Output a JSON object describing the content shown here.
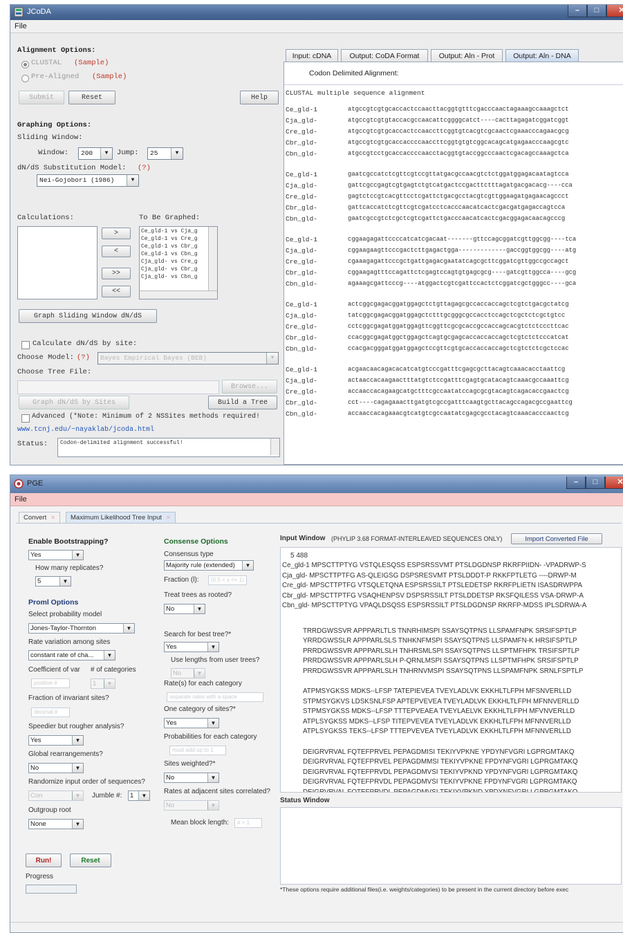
{
  "jcoda": {
    "title": "JCoDA",
    "menu": "File",
    "alignment_options": "Alignment Options:",
    "clustal": "CLUSTAL",
    "prealigned": "Pre-Aligned",
    "sample": "(Sample)",
    "submit": "Submit",
    "reset": "Reset",
    "help": "Help",
    "graphing_options": "Graphing Options:",
    "sliding_window": "Sliding Window:",
    "window_label": "Window:",
    "window_value": "200",
    "jump_label": "Jump:",
    "jump_value": "25",
    "model_label": "dN/dS Substitution Model:",
    "help_mark": "(?)",
    "model_value": "Nei-Gojobori (1986)",
    "calculations": "Calculations:",
    "to_be_graphed": "To Be Graphed:",
    "graphed_items": [
      "Ce_gld-1 vs Cja_g",
      "Ce_gld-1 vs Cre_g",
      "Ce_gld-1 vs Cbr_g",
      "Ce_gld-1 vs Cbn_g",
      "Cja_gld- vs Cre_g",
      "Cja_gld- vs Cbr_g",
      "Cja_gld- vs Cbn_g"
    ],
    "move_right": ">",
    "move_left": "<",
    "move_all_right": ">>",
    "move_all_left": "<<",
    "graph_btn": "Graph Sliding Window dN/dS",
    "calc_by_site": "Calculate dN/dS by site:",
    "choose_model": "Choose Model:",
    "choose_model_value": "Bayes Empirical Bayes (BEB)",
    "choose_tree": "Choose Tree File:",
    "browse": "Browse...",
    "graph_sites": "Graph dN/dS by Sites",
    "build_tree": "Build a Tree",
    "advanced": "Advanced (*Note: Minimum of 2 NSSites methods required!",
    "url": "www.tcnj.edu/~nayaklab/jcoda.html",
    "status_label": "Status:",
    "status_value": "Codon-delimited alignment successful!",
    "tabs": [
      "Input: cDNA",
      "Output: CoDA Format",
      "Output: Aln - Prot",
      "Output: Aln - DNA"
    ],
    "panel_title": "Codon Delimited Alignment:",
    "clustal_header": "CLUSTAL multiple sequence alignment",
    "alignment_blocks": [
      [
        {
          "name": "Ce_gld-1",
          "seq": "atgccgtcgtgcaccactccaacttacggtgtttcgacccaactagaaagccaaagctct"
        },
        {
          "name": "Cja_gld-",
          "seq": "atgccgtcgtgtaccacgccaacattcggggcatct----cacttagagatcggatcggt"
        },
        {
          "name": "Cre_gld-",
          "seq": "atgccgtcgtgcaccactccaaccttcggtgtcacgtcgcaactcgaaacccagaacgcg"
        },
        {
          "name": "Cbr_gld-",
          "seq": "atgccgtcgtgcaccaccccaaccttcggtgtgtcggcacagcatgagaacccaagcgtc"
        },
        {
          "name": "Cbn_gld-",
          "seq": "atgccgtcctgcaccaccccaacctacggtgtaccggcccaactcgacagccaaagctca"
        }
      ],
      [
        {
          "name": "Ce_gld-1",
          "seq": "gaatcgccatctcgttcgtccgttatgacgccaacgtctctggatggagacaatagtcca"
        },
        {
          "name": "Cja_gld-",
          "seq": "gattcgccgagtcgtgagtctgtcatgactccgacttctttagatgacgacacg----cca"
        },
        {
          "name": "Cre_gld-",
          "seq": "gagtctccgtcacgttcctcgattctgacgcctacgtcgttggaagatgagaacagccct"
        },
        {
          "name": "Cbr_gld-",
          "seq": "gattcaccatctcgttcgtcgatcctcacccaacatcactcgacgatgagaccagtcca"
        },
        {
          "name": "Cbn_gld-",
          "seq": "gaatcgccgtctcgctcgtcgattctgacccaacatcactcgacggagacaacagcccg"
        }
      ],
      [
        {
          "name": "Ce_gld-1",
          "seq": "cggaagagattccccatcatcgacaat-------gttccagcggatcgttggcgg----tca"
        },
        {
          "name": "Cja_gld-",
          "seq": "cggaagaagttcccgactcttgagactgga-------------gaccggtggcgg----atg"
        },
        {
          "name": "Cre_gld-",
          "seq": "cgaaagagattcccgctgattgagacgaatatcagcgcttcggatcgttggccgccagct"
        },
        {
          "name": "Cbr_gld-",
          "seq": "cggaagagtttccagattctcgagtccagtgtgagcgcg----gatcgttggcca----gcg"
        },
        {
          "name": "Cbn_gld-",
          "seq": "agaaagcgattcccg----atggactcgtcgattccactctcggatcgctgggcc----gca"
        }
      ],
      [
        {
          "name": "Ce_gld-1",
          "seq": "actcggcgagacggatggagctctgttagagcgccaccaccagctcgtctgacgctatcg"
        },
        {
          "name": "Cja_gld-",
          "seq": "tatcggcgagacggatggagctctttgcgggcgccacctccagctcgctctcgctgtcc"
        },
        {
          "name": "Cre_gld-",
          "seq": "cctcggcgagatggatggagttcggttcgcgcaccgccaccagcacgtctctcccttcac"
        },
        {
          "name": "Cbr_gld-",
          "seq": "ccacggcgagatggctggagctcagtgcgagcaccaccaccagctcgtctctcccatcat"
        },
        {
          "name": "Cbn_gld-",
          "seq": "ccacgacgggatggatggagctccgttcgtgcaccaccaccagctcgtctctcgctccac"
        }
      ],
      [
        {
          "name": "Ce_gld-1",
          "seq": "acgaacaacagacacatcatgtcccgatttcgagcgcttacagtcaaacacctaattcg"
        },
        {
          "name": "Cja_gld-",
          "seq": "actaaccacaagaactttatgtctccgatttcgagtgcatacagtcaaacgccaaattcg"
        },
        {
          "name": "Cre_gld-",
          "seq": "accaaccacagaagcatgctttcgccaatatccagcgcgtacagtcagacaccgaactcg"
        },
        {
          "name": "Cbr_gld-",
          "seq": "cct----cagagaaacttgatgtcgccgatttcaagtgcttacagccagacgccgaattcg"
        },
        {
          "name": "Cbn_gld-",
          "seq": "accaaccacagaaacgtcatgtcgccaatatcgagcgcctacagtcaaacacccaactcg"
        }
      ]
    ]
  },
  "pge": {
    "title": "PGE",
    "menu": "File",
    "tabs": [
      "Convert",
      "Maximum Likelihood Tree Input"
    ],
    "enable_bootstrapping": "Enable Bootstrapping?",
    "bootstrap_value": "Yes",
    "replicates_label": "How many replicates?",
    "replicates_value": "5",
    "proml_options": "Proml Options",
    "prob_model_label": "Select probability model",
    "prob_model_value": "Jones-Taylor-Thornton",
    "rate_variation_label": "Rate variation among sites",
    "rate_variation_value": "constant rate of cha...",
    "coef_var_label": "Coefficient of var",
    "num_categories_label": "# of categories",
    "coef_var_field": "positive #",
    "num_categories_value": "1",
    "invariant_label": "Fraction of invariant sites?",
    "invariant_field": "decimal #",
    "speedier_label": "Speedier but rougher analysis?",
    "speedier_value": "Yes",
    "global_rearr_label": "Global rearrangements?",
    "global_rearr_value": "No",
    "randomize_label": "Randomize input order of sequences?",
    "randomize_value": "Con",
    "jumble_label": "Jumble #:",
    "jumble_value": "1",
    "outgroup_label": "Outgroup root",
    "outgroup_value": "None",
    "run": "Run!",
    "reset": "Reset",
    "progress": "Progress",
    "consense_options": "Consense Options",
    "consensus_type_label": "Consensus type",
    "consensus_type_value": "Majority rule (extended)",
    "fraction_label": "Fraction (l):",
    "fraction_field": "(0.5 < x <= 1)",
    "treat_rooted_label": "Treat trees as rooted?",
    "treat_rooted_value": "No",
    "best_tree_label": "Search for best tree?*",
    "best_tree_value": "Yes",
    "use_lengths_label": "Use lengths from user trees?",
    "use_lengths_value": "No",
    "rates_category_label": "Rate(s) for each category",
    "rates_category_field": "separate rates with a space",
    "one_category_label": "One category of sites?*",
    "one_category_value": "Yes",
    "probabilities_label": "Probabilities for each category",
    "probabilities_field": "must add up to 1",
    "sites_weighted_label": "Sites weighted?*",
    "sites_weighted_value": "No",
    "adjacent_label": "Rates at adjacent sites correlated?",
    "adjacent_value": "No",
    "mean_block_label": "Mean block length:",
    "mean_block_field": "# > 1",
    "input_window_label": "Input Window",
    "input_window_note": "(PHYLIP 3.68 FORMAT-INTERLEAVED SEQUENCES ONLY)",
    "import_btn": "Import Converted File",
    "seq_header": "5  488",
    "seq_first_block": [
      "Ce_gld-1  MPSCTTPTYG VSTQLESQSS ESPSRSSVMT PTSLDGDNSP RKRFPIIDN- -VPADRWP-S",
      "Cja_gld-  MPSCTTPTFG AS-QLEIGSG DSPSRESVMT PTSLDDDT-P RKKFPTLETG ----DRWP-M",
      "Cre_gld-  MPSCTTPTFG VTSQLETQNA ESPSRSSILT PTSLEDETSP RKRFPLIETN ISASDRWPPA",
      "Cbr_gld-  MPSCTTPTFG VSAQHENPSV DSPSRSSILT PTSLDDETSP RKSFQILESS VSA-DRWP-A",
      "Cbn_gld-  MPSCTTPTYG VPAQLDSQSS ESPSRSSILT PTSLDGDNSP RKRFP-MDSS IPLSDRWA-A"
    ],
    "seq_blocks": [
      [
        "TRRDGWSSVR APPPARLTLS TNNRHIMSPI SSAYSQTPNS LLSPAMFNPK SRSIFSPTLP",
        "YRRDGWSSLR APPPARLSLS TNHKNFMSPI SSAYSQTPNS LLSPAMFN-K HRSIFSPTLP",
        "PRRDGWSSVR APPPARLSLH TNHRSMLSPI SSAYSQTPNS LLSPTMFHPK TRSIFSPTLP",
        "PRRDGWSSVR APPPARLSLH P-QRNLMSPI SSAYSQTPNS LLSPTMFHPK SRSIFSPTLP",
        "PRRDGWSSVR APPPARLSLH TNHRNVMSPI SSAYSQTPNS LLSPAMFNPK SRNLFSPTLP"
      ],
      [
        "ATPMSYGKSS MDKS--LFSP TATEPIEVEA TVEYLADLVK EKKHLTLFPH MFSNVERLLD",
        "STPMSYGKVS LDSKSNLFSP APTEPVEVEA TVEYLADLVK EKKHLTLFPH MFNNVERLLD",
        "STPMSYGKSS MDKS--LFSP TTTEPVEAEA TVEYLAELVK EKKHLTLFPH MFVNVERLLD",
        "ATPLSYGKSS MDKS--LFSP TITEPVEVEA TVEYLADLVK EKKHLTLFPH MFNNVERLLD",
        "ATPLSYGKSS TEKS--LFSP TTTEPVEVEA TVEYLADLVK EKKHLTLFPH MFNNVERLLD"
      ],
      [
        "DEIGRVRVAL FQTEFPRVEL PEPAGDMISI TEKIYVPKNE YPDYNFVGRI LGPRGMTAKQ",
        "DEIGRVRVAL FQTEFPRVEL PEPAGDMMSI TEKIYVPKNE FPDYNFVGRI LGPRGMTAKQ",
        "DEIGRVRVAL FQTEFPRVDL PEPAGDMVSI TEKIYVPKND YPDYNFVGRI LGPRGMTAKQ",
        "DEIGRVRVAL FQTEFPRVDL PEPAGDMVSI TEKIYVPKNE FPDYNFVGRI LGPRGMTAKQ",
        "DEIGRVRVAL FQTEFPRVDL PEPAGDMVSI TEKIYVPKND YPDYNFVGRI LGPRGMTAKQ"
      ]
    ],
    "status_window_label": "Status Window",
    "footnote": "*These options require additional files(i.e. weights/categories) to be present in the current directory before exec"
  }
}
